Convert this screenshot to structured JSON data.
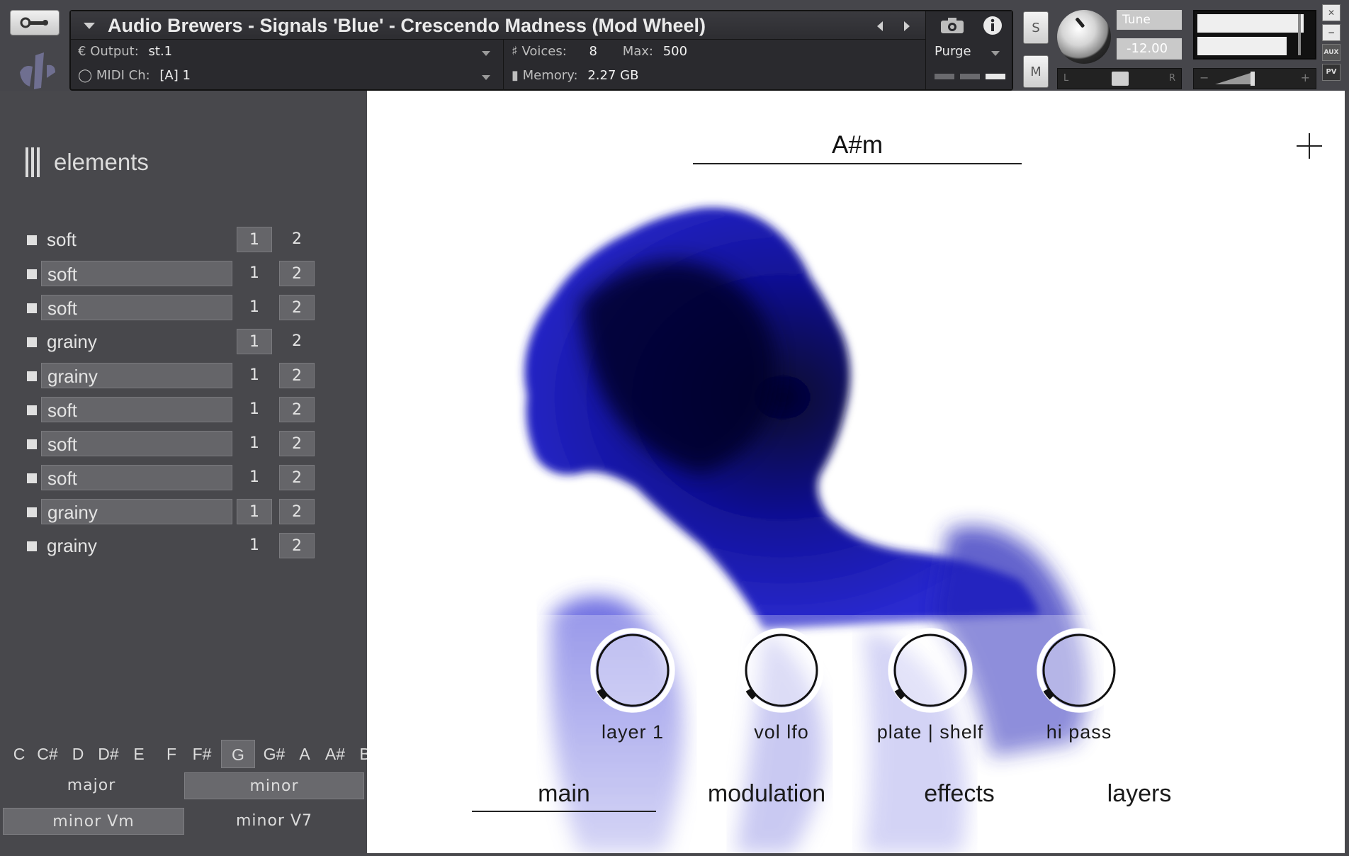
{
  "instrument": {
    "title": "Audio Brewers - Signals 'Blue' - Crescendo Madness (Mod Wheel)",
    "output_label": "Output:",
    "output_value": "st.1",
    "voices_label": "Voices:",
    "voices_value": "8",
    "max_label": "Max:",
    "max_value": "500",
    "midi_label": "MIDI Ch:",
    "midi_value": "[A]  1",
    "memory_label": "Memory:",
    "memory_value": "2.27 GB",
    "purge_label": "Purge",
    "solo_label": "S",
    "mute_label": "M",
    "tune_label": "Tune",
    "tune_value": "-12.00",
    "pan_left": "L",
    "pan_right": "R",
    "vol_minus": "−",
    "vol_plus": "+",
    "aux_label": "AUX",
    "pv_label": "PV",
    "close_label": "✕",
    "minimize_label": "−"
  },
  "sidebar": {
    "title": "elements",
    "elements": [
      {
        "name": "soft",
        "name_hl": false,
        "sel": 1
      },
      {
        "name": "soft",
        "name_hl": true,
        "sel": 2
      },
      {
        "name": "soft",
        "name_hl": true,
        "sel": 2
      },
      {
        "name": "grainy",
        "name_hl": false,
        "sel": 1
      },
      {
        "name": "grainy",
        "name_hl": true,
        "sel": 2
      },
      {
        "name": "soft",
        "name_hl": true,
        "sel": 2
      },
      {
        "name": "soft",
        "name_hl": true,
        "sel": 2
      },
      {
        "name": "soft",
        "name_hl": true,
        "sel": 2
      },
      {
        "name": "grainy",
        "name_hl": true,
        "sel": 12
      },
      {
        "name": "grainy",
        "name_hl": false,
        "sel": 2
      }
    ],
    "option_one": "1",
    "option_two": "2",
    "keys": [
      "C",
      "C#",
      "D",
      "D#",
      "E",
      "F",
      "F#",
      "G",
      "G#",
      "A",
      "A#",
      "B"
    ],
    "selected_key": "G",
    "scales": {
      "major": "major",
      "minor": "minor",
      "minor_vm": "minor Vm",
      "minor_v7": "minor V7"
    }
  },
  "main": {
    "key_display": "A#m",
    "knobs": [
      {
        "label": "layer 1",
        "value": 0.0
      },
      {
        "label": "vol lfo",
        "value": 0.0
      },
      {
        "label": "plate | shelf",
        "value": 0.0
      },
      {
        "label": "hi pass",
        "value": 0.0
      }
    ],
    "tabs": [
      "main",
      "modulation",
      "effects",
      "layers"
    ],
    "active_tab": "main"
  },
  "colors": {
    "accent_blue": "#1e1eb4",
    "smoke_dark": "#08083a",
    "panel_gray": "#48484c",
    "highlight_gray": "#656569"
  }
}
